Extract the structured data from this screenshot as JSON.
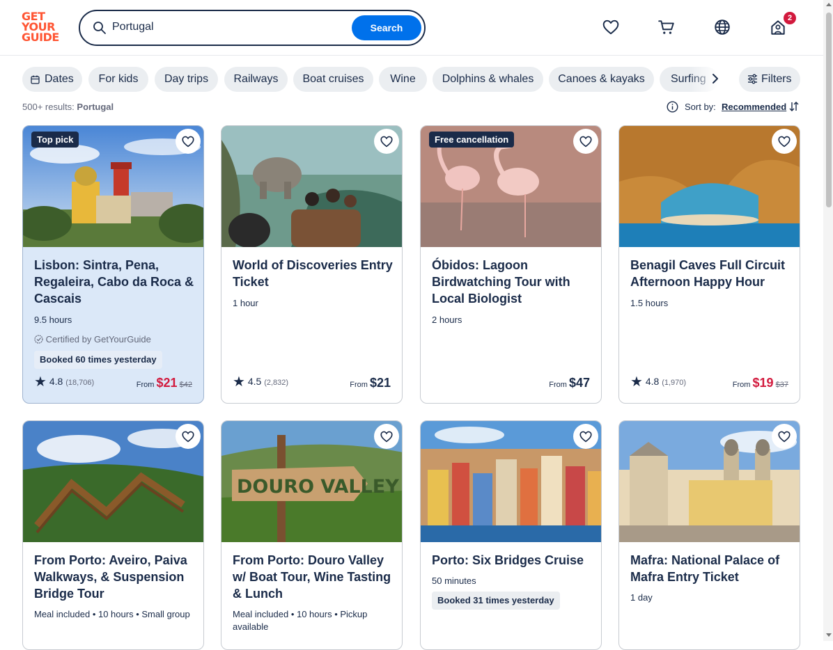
{
  "header": {
    "logo_lines": [
      "GET",
      "YOUR",
      "GUIDE"
    ],
    "search_value": "Portugal",
    "search_button": "Search",
    "cart_badge": "2"
  },
  "chips": [
    "Dates",
    "For kids",
    "Day trips",
    "Railways",
    "Boat cruises",
    "Wine",
    "Dolphins & whales",
    "Canoes & kayaks",
    "Surfing"
  ],
  "filters_label": "Filters",
  "results": {
    "count": "500+ results:",
    "query": "Portugal"
  },
  "sort": {
    "label": "Sort by:",
    "value": "Recommended"
  },
  "cards": [
    {
      "tag": "Top pick",
      "title": "Lisbon: Sintra, Pena, Regaleira, Cabo da Roca & Cascais",
      "duration": "9.5 hours",
      "certified": "Certified by GetYourGuide",
      "booked": "Booked 60 times yesterday",
      "rating": "4.8",
      "reviews": "(18,706)",
      "from": "From",
      "price": "$21",
      "was": "$42"
    },
    {
      "title": "World of Discoveries Entry Ticket",
      "duration": "1 hour",
      "rating": "4.5",
      "reviews": "(2,832)",
      "from": "From",
      "price": "$21"
    },
    {
      "tag": "Free cancellation",
      "title": "Óbidos: Lagoon Birdwatching Tour with Local Biologist",
      "duration": "2 hours",
      "from": "From",
      "price": "$47"
    },
    {
      "title": "Benagil Caves Full Circuit Afternoon Happy Hour",
      "duration": "1.5 hours",
      "rating": "4.8",
      "reviews": "(1,970)",
      "from": "From",
      "price": "$19",
      "was": "$37"
    },
    {
      "title": "From Porto: Aveiro, Paiva Walkways, & Suspension Bridge Tour",
      "duration": "Meal included • 10 hours • Small group"
    },
    {
      "title": "From Porto: Douro Valley w/ Boat Tour, Wine Tasting & Lunch",
      "duration": "Meal included • 10 hours • Pickup available",
      "sign_text": "DOURO VALLEY"
    },
    {
      "title": "Porto: Six Bridges Cruise",
      "duration": "50 minutes",
      "booked": "Booked 31 times yesterday"
    },
    {
      "title": "Mafra: National Palace of Mafra Entry Ticket",
      "duration": "1 day"
    }
  ]
}
